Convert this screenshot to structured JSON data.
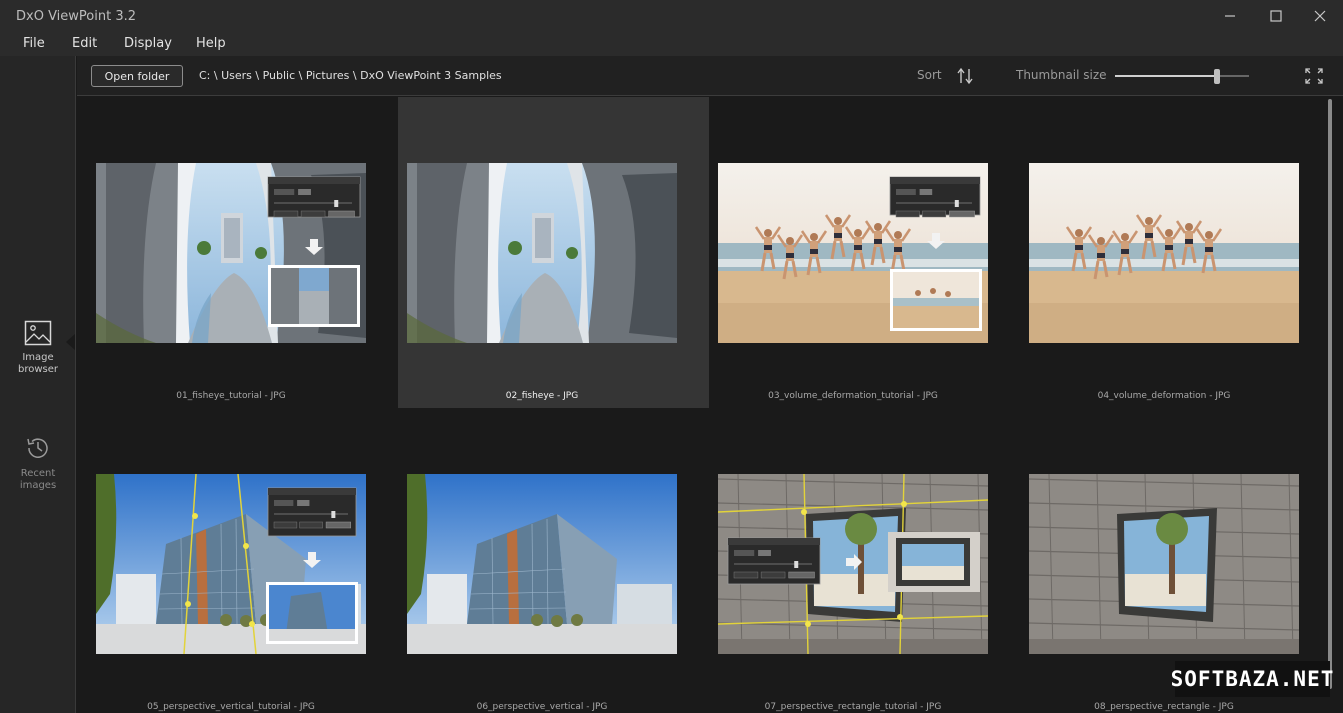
{
  "window": {
    "title": "DxO ViewPoint 3.2"
  },
  "menu": [
    "File",
    "Edit",
    "Display",
    "Help"
  ],
  "rail": {
    "image_browser": "Image browser",
    "recent_images": "Recent images"
  },
  "toolbar": {
    "open_folder": "Open folder",
    "path": "C: \\ Users \\ Public \\ Pictures \\ DxO ViewPoint 3 Samples",
    "sort_label": "Sort",
    "thumbnail_size_label": "Thumbnail size",
    "thumbnail_size_value": 0.76
  },
  "images": [
    {
      "caption": "01_fisheye_tutorial - JPG",
      "kind": "fisheye",
      "tutorial": true,
      "selected": false
    },
    {
      "caption": "02_fisheye - JPG",
      "kind": "fisheye",
      "tutorial": false,
      "selected": true
    },
    {
      "caption": "03_volume_deformation_tutorial - JPG",
      "kind": "beach",
      "tutorial": true,
      "selected": false
    },
    {
      "caption": "04_volume_deformation - JPG",
      "kind": "beach",
      "tutorial": false,
      "selected": false
    },
    {
      "caption": "05_perspective_vertical_tutorial - JPG",
      "kind": "building",
      "tutorial": true,
      "selected": false
    },
    {
      "caption": "06_perspective_vertical - JPG",
      "kind": "building",
      "tutorial": false,
      "selected": false
    },
    {
      "caption": "07_perspective_rectangle_tutorial - JPG",
      "kind": "stonewall",
      "tutorial": true,
      "selected": false
    },
    {
      "caption": "08_perspective_rectangle - JPG",
      "kind": "stonewall",
      "tutorial": false,
      "selected": false
    }
  ],
  "watermark": "SOFTBAZA.NET",
  "colors": {
    "background": "#1a1a1a",
    "selected_cell": "#353535",
    "chrome": "#2b2b2b"
  }
}
